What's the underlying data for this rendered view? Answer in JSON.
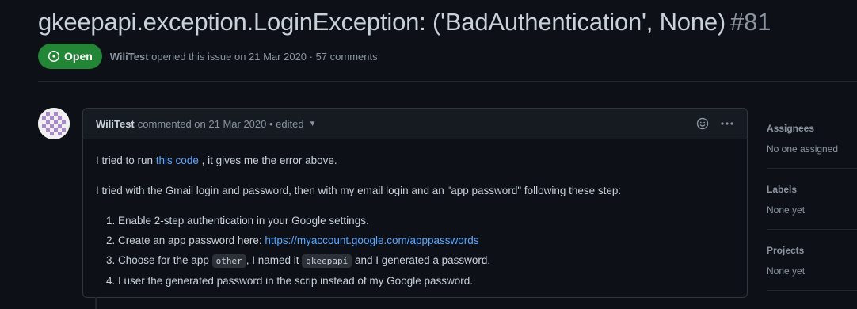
{
  "issue": {
    "title": "gkeepapi.exception.LoginException: ('BadAuthentication', None)",
    "number": "#81",
    "state": "Open",
    "author": "WiliTest",
    "meta": "opened this issue on 21 Mar 2020 · 57 comments"
  },
  "comment": {
    "author": "WiliTest",
    "meta": "commented on 21 Mar 2020 • edited",
    "line1_before": "I tried to run ",
    "line1_link": "this code",
    "line1_after": " , it gives me the error above.",
    "line2": "I tried with the Gmail login and password, then with my email login and an \"app password\" following these step:",
    "steps": {
      "s1": "Enable 2-step authentication in your Google settings.",
      "s2_text": "Create an app password here: ",
      "s2_link": "https://myaccount.google.com/apppasswords",
      "s3_a": "Choose for the app ",
      "s3_code1": "other",
      "s3_b": ", I named it ",
      "s3_code2": "gkeepapi",
      "s3_c": " and I generated a password.",
      "s4": "I user the generated password in the scrip instead of my Google password."
    }
  },
  "sidebar": {
    "assignees_heading": "Assignees",
    "assignees_value": "No one assigned",
    "labels_heading": "Labels",
    "labels_value": "None yet",
    "projects_heading": "Projects",
    "projects_value": "None yet"
  },
  "colors": {
    "open_badge": "#238636",
    "link": "#58a6ff",
    "background": "#0d1117"
  }
}
